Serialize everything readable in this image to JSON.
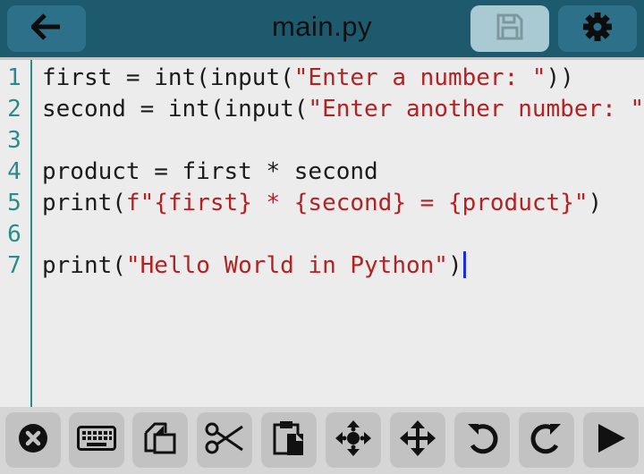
{
  "header": {
    "title": "main.py",
    "back_icon": "arrow-left-icon",
    "save_icon": "floppy-disk-icon",
    "settings_icon": "gear-icon"
  },
  "editor": {
    "lines": [
      {
        "num": "1",
        "parts": [
          {
            "t": "first = int(input(",
            "c": "code"
          },
          {
            "t": "\"Enter a number: \"",
            "c": "str"
          },
          {
            "t": "))",
            "c": "code"
          }
        ]
      },
      {
        "num": "2",
        "parts": [
          {
            "t": "second = int(input(",
            "c": "code"
          },
          {
            "t": "\"Enter another number: \"",
            "c": "str"
          },
          {
            "t": "))",
            "c": "code"
          }
        ]
      },
      {
        "num": "3",
        "parts": []
      },
      {
        "num": "4",
        "parts": [
          {
            "t": "product = first * second",
            "c": "code"
          }
        ]
      },
      {
        "num": "5",
        "parts": [
          {
            "t": "print(",
            "c": "code"
          },
          {
            "t": "f\"{first} * {second} = {product}\"",
            "c": "str"
          },
          {
            "t": ")",
            "c": "code"
          }
        ]
      },
      {
        "num": "6",
        "parts": []
      },
      {
        "num": "7",
        "parts": [
          {
            "t": "print(",
            "c": "code"
          },
          {
            "t": "\"Hello World in Python\"",
            "c": "str"
          },
          {
            "t": ")",
            "c": "code"
          }
        ],
        "cursor": true
      }
    ]
  },
  "toolbar": {
    "buttons": [
      {
        "name": "close-button",
        "icon": "close-circle-icon"
      },
      {
        "name": "keyboard-button",
        "icon": "keyboard-icon"
      },
      {
        "name": "copy-button",
        "icon": "copy-icon"
      },
      {
        "name": "cut-button",
        "icon": "scissors-icon"
      },
      {
        "name": "paste-button",
        "icon": "paste-icon"
      },
      {
        "name": "move-select-button",
        "icon": "move-dots-icon"
      },
      {
        "name": "move-button",
        "icon": "move-arrows-icon"
      },
      {
        "name": "undo-button",
        "icon": "undo-icon"
      },
      {
        "name": "redo-button",
        "icon": "redo-icon"
      },
      {
        "name": "run-button",
        "icon": "play-icon"
      }
    ]
  },
  "colors": {
    "header_bg": "#1e5a6e",
    "string": "#b22222",
    "line_number": "#2a8c8a",
    "cursor": "#1a2ee0"
  }
}
